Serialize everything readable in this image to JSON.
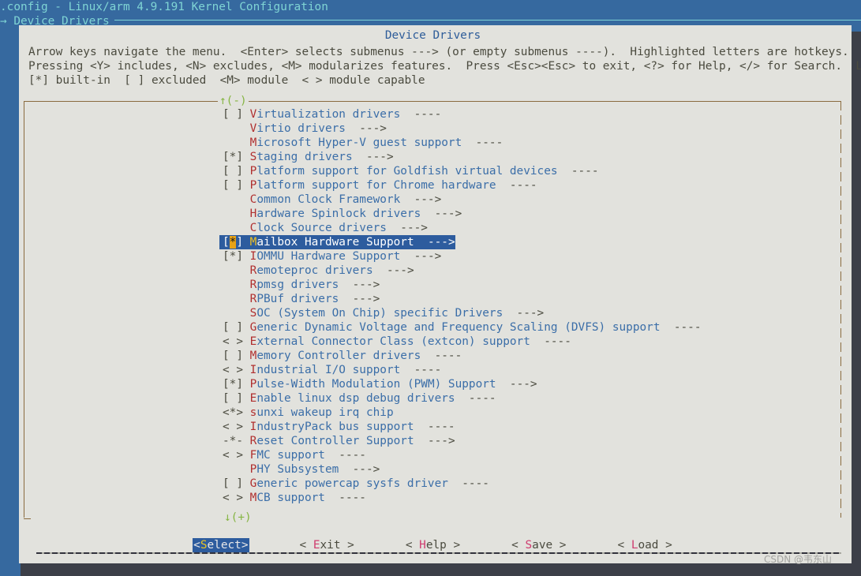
{
  "window": {
    "title": ".config - Linux/arm 4.9.191 Kernel Configuration",
    "breadcrumb_arrow": "→",
    "breadcrumb": "Device Drivers"
  },
  "dialog": {
    "title": "Device Drivers",
    "help_line_1": "Arrow keys navigate the menu.  <Enter> selects submenus ---> (or empty submenus ----).  Highlighted letters are hotkeys.",
    "help_line_2": "Pressing <Y> includes, <N> excludes, <M> modularizes features.  Press <Esc><Esc> to exit, <?> for Help, </> for Search.  Legend:",
    "help_line_3": "[*] built-in  [ ] excluded  <M> module  < > module capable",
    "scroll_up_indicator": "↑(-)",
    "scroll_down_indicator": "↓(+)"
  },
  "menu": {
    "items": [
      {
        "mark": "[ ] ",
        "hot": "V",
        "label": "irtualization drivers",
        "arrow": "  ----",
        "selected": false
      },
      {
        "mark": "    ",
        "hot": "V",
        "label": "irtio drivers",
        "arrow": "  --->",
        "selected": false
      },
      {
        "mark": "    ",
        "hot": "M",
        "label": "icrosoft Hyper-V guest support",
        "arrow": "  ----",
        "selected": false
      },
      {
        "mark": "[*] ",
        "hot": "S",
        "label": "taging drivers",
        "arrow": "  --->",
        "selected": false
      },
      {
        "mark": "[ ] ",
        "hot": "P",
        "label": "latform support for Goldfish virtual devices",
        "arrow": "  ----",
        "selected": false
      },
      {
        "mark": "[ ] ",
        "hot": "P",
        "label": "latform support for Chrome hardware",
        "arrow": "  ----",
        "selected": false
      },
      {
        "mark": "    ",
        "hot": "C",
        "label": "ommon Clock Framework",
        "arrow": "  --->",
        "selected": false
      },
      {
        "mark": "    ",
        "hot": "H",
        "label": "ardware Spinlock drivers",
        "arrow": "  --->",
        "selected": false
      },
      {
        "mark": "    ",
        "hot": "C",
        "label": "lock Source drivers",
        "arrow": "  --->",
        "selected": false
      },
      {
        "mark": "[*] ",
        "hot": "M",
        "label": "ailbox Hardware Support",
        "arrow": "  --->",
        "selected": true
      },
      {
        "mark": "[*] ",
        "hot": "I",
        "label": "OMMU Hardware Support",
        "arrow": "  --->",
        "selected": false
      },
      {
        "mark": "    ",
        "hot": "R",
        "label": "emoteproc drivers",
        "arrow": "  --->",
        "selected": false
      },
      {
        "mark": "    ",
        "hot": "R",
        "label": "pmsg drivers",
        "arrow": "  --->",
        "selected": false
      },
      {
        "mark": "    ",
        "hot": "R",
        "label": "PBuf drivers",
        "arrow": "  --->",
        "selected": false
      },
      {
        "mark": "    ",
        "hot": "S",
        "label": "OC (System On Chip) specific Drivers",
        "arrow": "  --->",
        "selected": false
      },
      {
        "mark": "[ ] ",
        "hot": "G",
        "label": "eneric Dynamic Voltage and Frequency Scaling (DVFS) support",
        "arrow": "  ----",
        "selected": false
      },
      {
        "mark": "< > ",
        "hot": "E",
        "label": "xternal Connector Class (extcon) support",
        "arrow": "  ----",
        "selected": false
      },
      {
        "mark": "[ ] ",
        "hot": "M",
        "label": "emory Controller drivers",
        "arrow": "  ----",
        "selected": false
      },
      {
        "mark": "< > ",
        "hot": "I",
        "label": "ndustrial I/O support",
        "arrow": "  ----",
        "selected": false
      },
      {
        "mark": "[*] ",
        "hot": "P",
        "label": "ulse-Width Modulation (PWM) Support",
        "arrow": "  --->",
        "selected": false
      },
      {
        "mark": "[ ] ",
        "hot": "E",
        "label": "nable linux dsp debug drivers",
        "arrow": "  ----",
        "selected": false
      },
      {
        "mark": "<*> ",
        "hot": "s",
        "label": "unxi wakeup irq chip",
        "arrow": "",
        "selected": false
      },
      {
        "mark": "< > ",
        "hot": "I",
        "label": "ndustryPack bus support",
        "arrow": "  ----",
        "selected": false
      },
      {
        "mark": "-*- ",
        "hot": "R",
        "label": "eset Controller Support",
        "arrow": "  --->",
        "selected": false
      },
      {
        "mark": "< > ",
        "hot": "F",
        "label": "MC support",
        "arrow": "  ----",
        "selected": false
      },
      {
        "mark": "    ",
        "hot": "P",
        "label": "HY Subsystem",
        "arrow": "  --->",
        "selected": false
      },
      {
        "mark": "[ ] ",
        "hot": "G",
        "label": "eneric powercap sysfs driver",
        "arrow": "  ----",
        "selected": false
      },
      {
        "mark": "< > ",
        "hot": "M",
        "label": "CB support",
        "arrow": "  ----",
        "selected": false
      }
    ]
  },
  "buttons": [
    {
      "pre": "<",
      "hot": "S",
      "post": "elect>",
      "active": true
    },
    {
      "pre": "< ",
      "hot": "E",
      "post": "xit >",
      "active": false
    },
    {
      "pre": "< ",
      "hot": "H",
      "post": "elp >",
      "active": false
    },
    {
      "pre": "< ",
      "hot": "S",
      "post": "ave >",
      "active": false
    },
    {
      "pre": "< ",
      "hot": "L",
      "post": "oad >",
      "active": false
    }
  ],
  "watermark": {
    "text": "CSDN @韦东山"
  },
  "colors": {
    "background_blue": "#36699f",
    "dialog_bg": "#e2e2dd",
    "title_blue": "#2d5c99",
    "menu_text": "#3b6ea8",
    "hotkey_red": "#b03030",
    "selection_blue": "#2d5c9e",
    "selection_hot": "#f0c020",
    "star_orange": "#e8a317",
    "scroll_green": "#86b544",
    "button_hot": "#cf3b6e",
    "titlebar_cyan": "#7fd4d4",
    "frame_brown": "#8a6b3f",
    "shadow": "#3c3f48"
  }
}
